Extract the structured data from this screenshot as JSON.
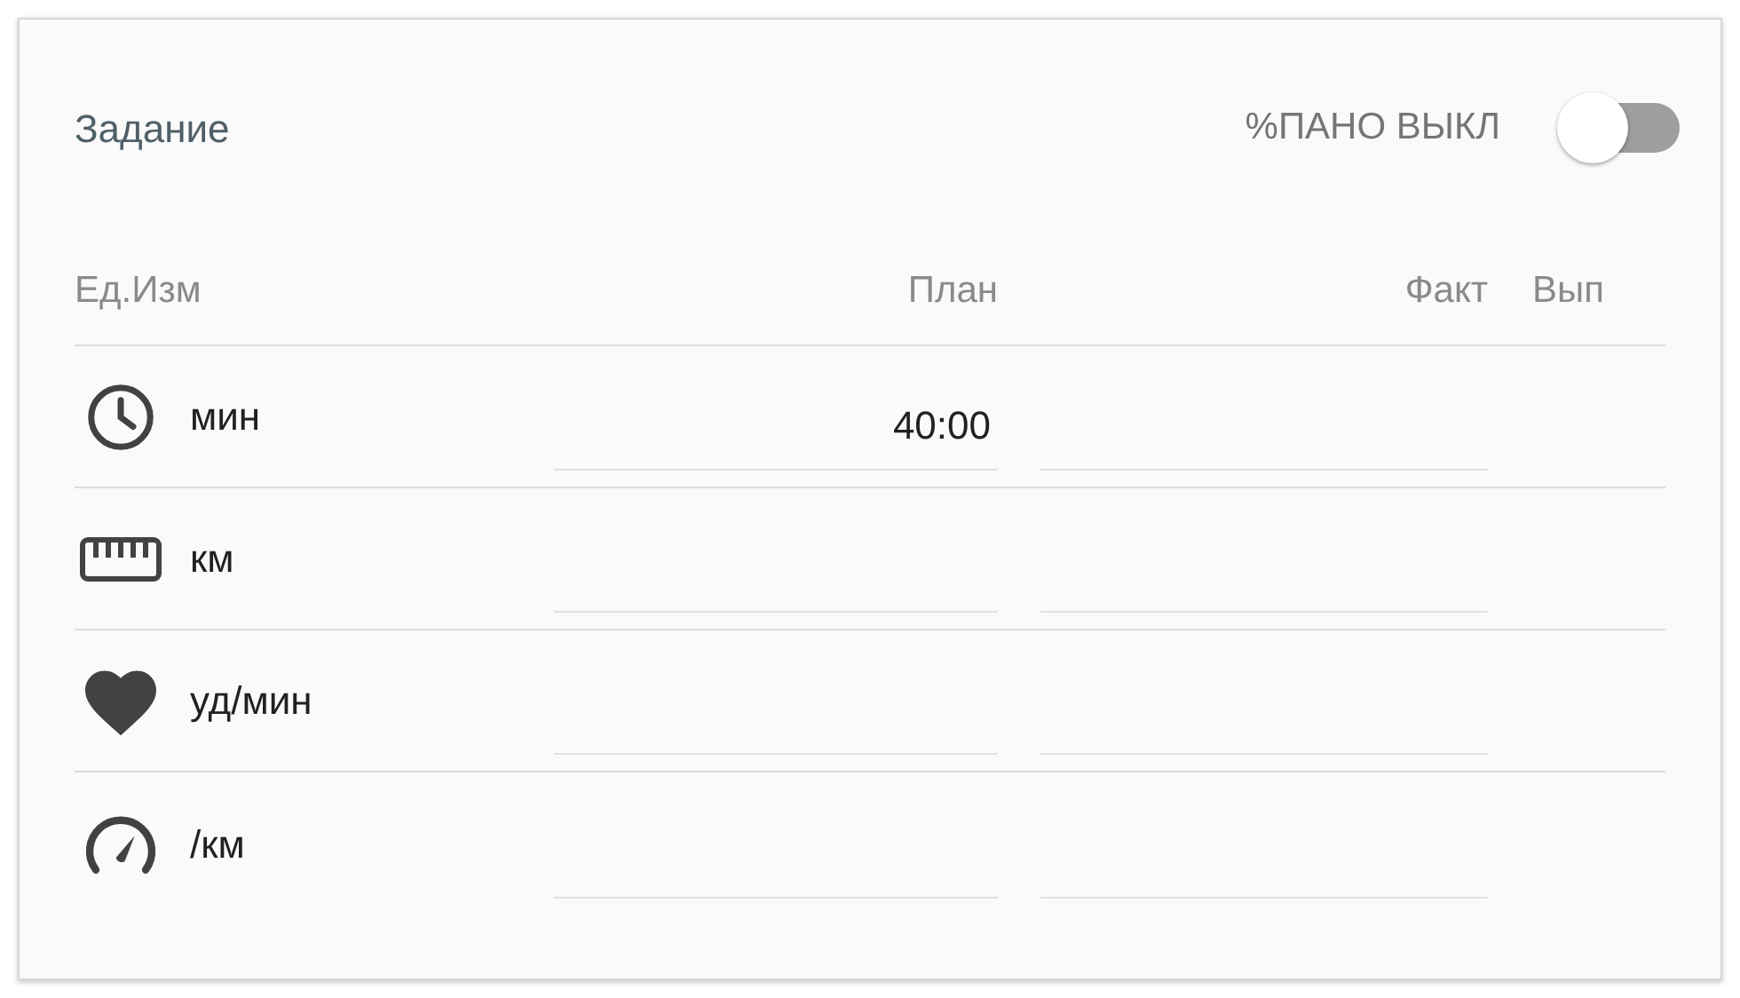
{
  "title": "Задание",
  "toggle": {
    "label": "%ПАНО ВЫКЛ",
    "on": false
  },
  "columns": [
    "Ед.Изм",
    "План",
    "Факт",
    "Вып"
  ],
  "rows": [
    {
      "kind": "clock",
      "unit": "мин",
      "plan": "40:00"
    },
    {
      "kind": "ruler",
      "unit": "км"
    },
    {
      "kind": "heart",
      "unit": "уд/мин"
    },
    {
      "kind": "gauge",
      "unit": "/км"
    }
  ]
}
